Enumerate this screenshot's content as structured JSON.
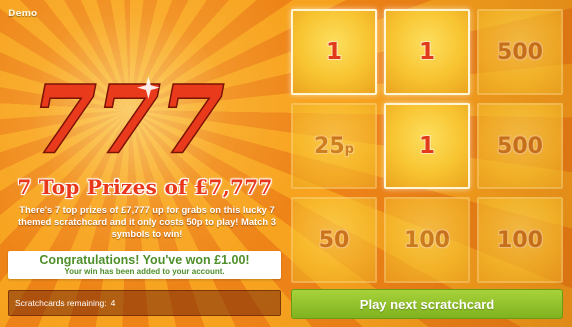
{
  "mode_label": "Demo",
  "logo": {
    "text": "777"
  },
  "headline": "7 Top Prizes of £7,777",
  "description": "There's 7 top prizes of £7,777 up for grabs on this lucky 7 themed scratchcard and it only costs 50p to play! Match 3 symbols to win!",
  "win": {
    "title": "Congratulations! You've won £1.00!",
    "subtitle": "Your win has been added to your account."
  },
  "remaining": {
    "label": "Scratchcards remaining:",
    "count": "4"
  },
  "grid": [
    {
      "value": "1",
      "unit": "",
      "state": "match"
    },
    {
      "value": "1",
      "unit": "",
      "state": "match"
    },
    {
      "value": "500",
      "unit": "",
      "state": "dim"
    },
    {
      "value": "25",
      "unit": "p",
      "state": "dim"
    },
    {
      "value": "1",
      "unit": "",
      "state": "match"
    },
    {
      "value": "500",
      "unit": "",
      "state": "dim"
    },
    {
      "value": "50",
      "unit": "",
      "state": "dim"
    },
    {
      "value": "100",
      "unit": "",
      "state": "dim"
    },
    {
      "value": "100",
      "unit": "",
      "state": "dim"
    }
  ],
  "play_button": {
    "label": "Play next scratchcard"
  },
  "colors": {
    "accent_red": "#e8371a",
    "win_green": "#4e8f2a",
    "button_green": "#8fc12a",
    "tile_gold": "#f8c431"
  }
}
